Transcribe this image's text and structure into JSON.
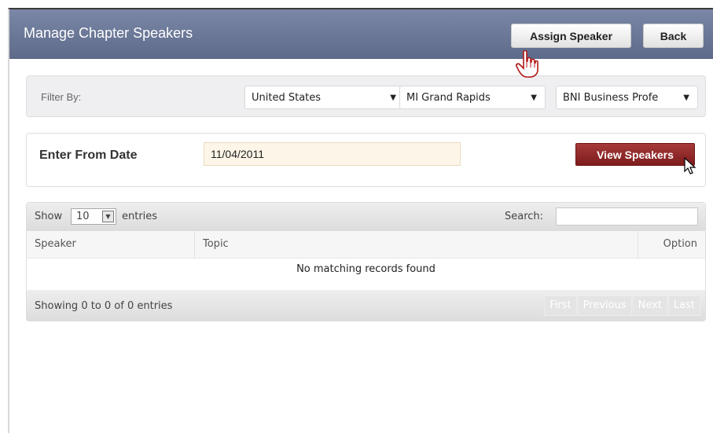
{
  "header": {
    "title": "Manage Chapter Speakers",
    "assign_label": "Assign Speaker",
    "back_label": "Back"
  },
  "filter": {
    "label": "Filter By:",
    "country": "United States",
    "region": "MI Grand Rapids",
    "chapter": "BNI Business Profe"
  },
  "date_form": {
    "label": "Enter From Date",
    "value": "11/04/2011",
    "button_label": "View Speakers"
  },
  "table": {
    "show_label": "Show",
    "page_size": "10",
    "entries_label": "entries",
    "search_label": "Search:",
    "search_value": "",
    "columns": [
      "Speaker",
      "Topic",
      "Option"
    ],
    "empty_message": "No matching records found",
    "info": "Showing 0 to 0 of 0 entries",
    "pager": [
      "First",
      "Previous",
      "Next",
      "Last"
    ]
  },
  "icons": {
    "dropdown": "triangle-down-icon",
    "cursor_hand": "hand-pointer-cursor-icon",
    "cursor_arrow": "arrow-pointer-cursor-icon"
  },
  "colors": {
    "header_bg": "#6b7898",
    "view_button": "#8b2525",
    "date_input_bg": "#fdf6e8"
  }
}
